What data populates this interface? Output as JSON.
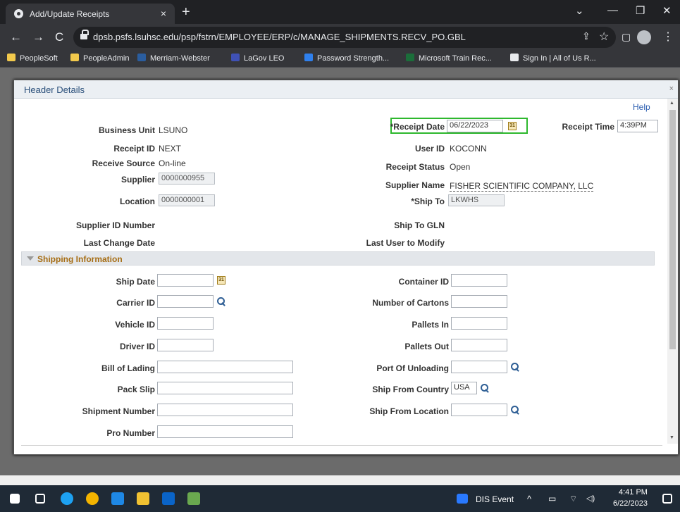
{
  "browser": {
    "tab_title": "Add/Update Receipts",
    "tab_close": "×",
    "new_tab": "+",
    "url": "dpsb.psfs.lsuhsc.edu/psp/fstrn/EMPLOYEE/ERP/c/MANAGE_SHIPMENTS.RECV_PO.GBL",
    "nav": {
      "back": "←",
      "forward": "→",
      "reload": "C"
    },
    "window_controls": {
      "dropdown": "⌄",
      "minimize": "—",
      "restore": "❐",
      "close": "✕"
    },
    "icons": {
      "share": "⇪",
      "star": "☆",
      "sidebar": "▢",
      "menu": "⋮"
    },
    "bookmarks": [
      {
        "label": "PeopleSoft",
        "color": "#f2c94c"
      },
      {
        "label": "PeopleAdmin",
        "color": "#f2c94c"
      },
      {
        "label": "Merriam-Webster",
        "color": "#2a5d9f"
      },
      {
        "label": "LaGov LEO",
        "color": "#3f51b5"
      },
      {
        "label": "Password Strength...",
        "color": "#2f80ed"
      },
      {
        "label": "Microsoft Train Rec...",
        "color": "#1b6e3a"
      },
      {
        "label": "Sign In | All of Us R...",
        "color": "#e8eaed"
      }
    ]
  },
  "modal": {
    "title": "Header Details",
    "close": "×",
    "help": "Help",
    "header": {
      "business_unit_label": "Business Unit",
      "business_unit": "LSUNO",
      "receipt_id_label": "Receipt ID",
      "receipt_id": "NEXT",
      "receive_source_label": "Receive Source",
      "receive_source": "On-line",
      "supplier_label": "Supplier",
      "supplier": "0000000955",
      "location_label": "Location",
      "location": "0000000001",
      "supplier_id_number_label": "Supplier ID Number",
      "last_change_date_label": "Last Change Date",
      "receipt_date_label": "*Receipt Date",
      "receipt_date": "06/22/2023",
      "receipt_time_label": "Receipt Time",
      "receipt_time": "4:39PM",
      "user_id_label": "User ID",
      "user_id": "KOCONN",
      "receipt_status_label": "Receipt Status",
      "receipt_status": "Open",
      "supplier_name_label": "Supplier Name",
      "supplier_name": "FISHER SCIENTIFIC COMPANY, LLC",
      "ship_to_label": "*Ship To",
      "ship_to": "LKWHS",
      "ship_to_gln_label": "Ship To GLN",
      "last_user_label": "Last User to Modify"
    },
    "shipping": {
      "title": "Shipping Information",
      "ship_date_label": "Ship Date",
      "carrier_id_label": "Carrier ID",
      "vehicle_id_label": "Vehicle ID",
      "driver_id_label": "Driver ID",
      "bill_of_lading_label": "Bill of Lading",
      "pack_slip_label": "Pack Slip",
      "shipment_number_label": "Shipment Number",
      "pro_number_label": "Pro Number",
      "container_id_label": "Container ID",
      "number_of_cartons_label": "Number of Cartons",
      "pallets_in_label": "Pallets In",
      "pallets_out_label": "Pallets Out",
      "port_of_unloading_label": "Port Of Unloading",
      "ship_from_country_label": "Ship From Country",
      "ship_from_country": "USA",
      "ship_from_location_label": "Ship From Location"
    },
    "calendar_glyph": "31"
  },
  "taskbar": {
    "notification_title": "DIS Event",
    "time": "4:41 PM",
    "date": "6/22/2023",
    "tray": {
      "chevron": "^",
      "battery": "▭",
      "wifi": "⌔",
      "volume": "◁)"
    }
  }
}
